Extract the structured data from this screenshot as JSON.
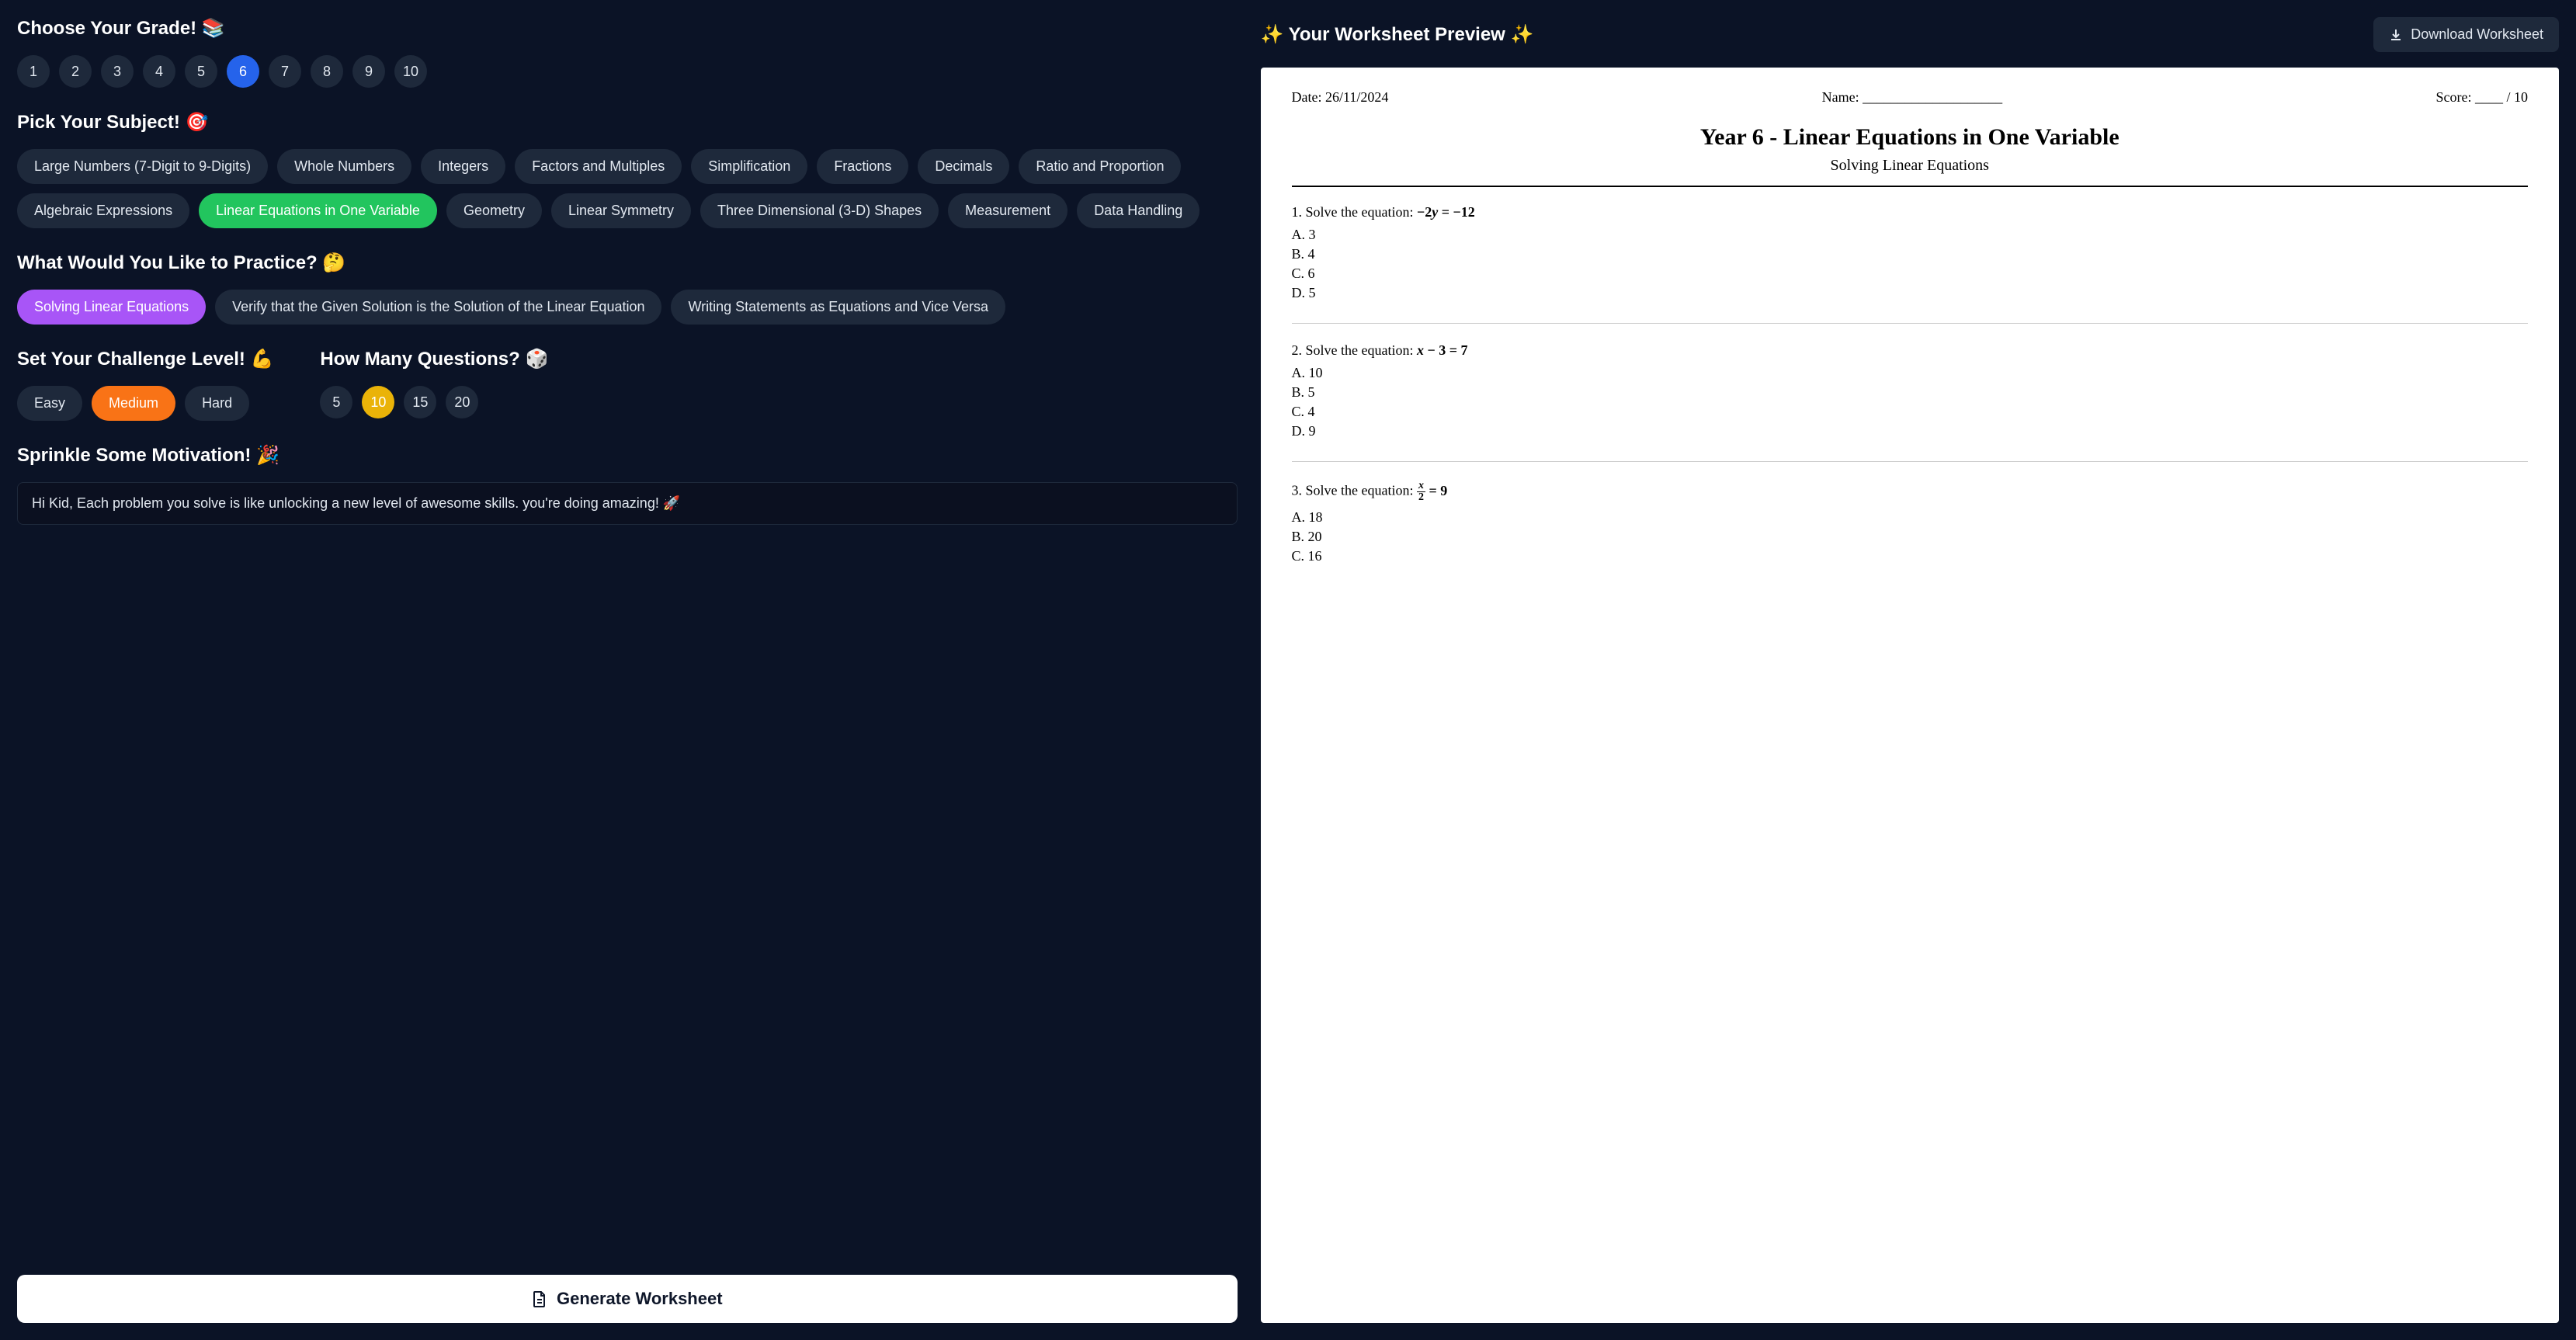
{
  "left": {
    "grade_title": "Choose Your Grade! 📚",
    "grades": [
      "1",
      "2",
      "3",
      "4",
      "5",
      "6",
      "7",
      "8",
      "9",
      "10"
    ],
    "grades_selected": "6",
    "subject_title": "Pick Your Subject! 🎯",
    "subjects": [
      "Large Numbers (7-Digit to 9-Digits)",
      "Whole Numbers",
      "Integers",
      "Factors and Multiples",
      "Simplification",
      "Fractions",
      "Decimals",
      "Ratio and Proportion",
      "Algebraic Expressions",
      "Linear Equations in One Variable",
      "Geometry",
      "Linear Symmetry",
      "Three Dimensional (3-D) Shapes",
      "Measurement",
      "Data Handling"
    ],
    "subjects_selected": "Linear Equations in One Variable",
    "practice_title": "What Would You Like to Practice? 🤔",
    "practices": [
      "Solving Linear Equations",
      "Verify that the Given Solution is the Solution of the Linear Equation",
      "Writing Statements as Equations and Vice Versa"
    ],
    "practices_selected": "Solving Linear Equations",
    "challenge_title": "Set Your Challenge Level! 💪",
    "levels": [
      "Easy",
      "Medium",
      "Hard"
    ],
    "levels_selected": "Medium",
    "count_title": "How Many Questions? 🎲",
    "counts": [
      "5",
      "10",
      "15",
      "20"
    ],
    "counts_selected": "10",
    "motivation_title": "Sprinkle Some Motivation! 🎉",
    "motivation_value": "Hi Kid, Each problem you solve is like unlocking a new level of awesome skills. you're doing amazing! 🚀",
    "generate_label": "Generate Worksheet"
  },
  "right": {
    "preview_title": "✨ Your Worksheet Preview ✨",
    "download_label": "Download Worksheet",
    "worksheet": {
      "date": "Date: 26/11/2024",
      "name": "Name: ____________________",
      "score": "Score: ____ / 10",
      "title": "Year 6 - Linear Equations in One Variable",
      "subtitle": "Solving Linear Equations",
      "questions": [
        {
          "prompt": "1. Solve the equation:",
          "equation_html": "−2<i>y</i> = −12",
          "options": [
            "A. 3",
            "B. 4",
            "C. 6",
            "D. 5"
          ]
        },
        {
          "prompt": "2. Solve the equation:",
          "equation_html": "<i>x</i> − 3 = 7",
          "options": [
            "A. 10",
            "B. 5",
            "C. 4",
            "D. 9"
          ]
        },
        {
          "prompt": "3. Solve the equation:",
          "equation_html": "<span class=\"frac\"><span class=\"num\"><i>x</i></span><span class=\"den\">2</span></span> = 9",
          "options": [
            "A. 18",
            "B. 20",
            "C. 16"
          ]
        }
      ]
    }
  }
}
